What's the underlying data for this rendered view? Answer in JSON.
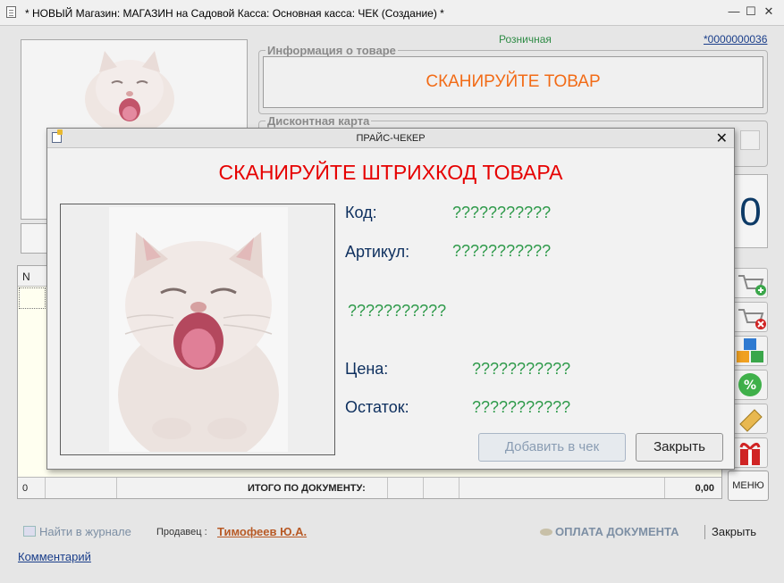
{
  "window": {
    "title": "* НОВЫЙ Магазин: МАГАЗИН на Садовой Касса: Основная касса: ЧЕК (Создание) *",
    "minimize": "—",
    "maximize": "☐",
    "close": "✕"
  },
  "header": {
    "price_type": "Розничная",
    "doc_number": "*0000000036"
  },
  "product_info": {
    "legend": "Информация о товаре",
    "scan_prompt": "СКАНИРУЙТЕ ТОВАР"
  },
  "discount_card": {
    "legend": "Дисконтная карта"
  },
  "total_display": "0",
  "table": {
    "columns": [
      "N"
    ],
    "footer": {
      "count": "0",
      "label": "ИТОГО ПО ДОКУМЕНТУ:",
      "sum": "0,00"
    }
  },
  "side_buttons": {
    "menu_label": "МЕНЮ"
  },
  "bottom": {
    "find_in_journal": "Найти в журнале",
    "seller_label": "Продавец :",
    "seller_name": "Тимофеев Ю.А.",
    "pay_document": "ОПЛАТА ДОКУМЕНТА",
    "close": "Закрыть",
    "comment": "Комментарий"
  },
  "dialog": {
    "title": "ПРАЙС-ЧЕКЕР",
    "heading": "СКАНИРУЙТЕ ШТРИХКОД ТОВАРА",
    "fields": {
      "code_label": "Код:",
      "code_value": "???????????",
      "article_label": "Артикул:",
      "article_value": "???????????",
      "name_value": "???????????",
      "price_label": "Цена:",
      "price_value": "???????????",
      "stock_label": "Остаток:",
      "stock_value": "???????????"
    },
    "add_button": "Добавить в чек",
    "close_button": "Закрыть"
  },
  "colors": {
    "scan_orange": "#f26b16",
    "heading_red": "#e60000",
    "value_green": "#2e9a4a",
    "label_navy": "#0d2f5e"
  }
}
